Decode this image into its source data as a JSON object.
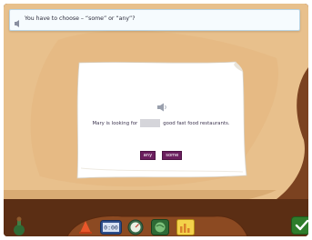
{
  "instruction": {
    "text": "You have to choose – “some” or “any”?"
  },
  "exercise": {
    "sentence_before": "Mary is looking for",
    "sentence_after": "good fast food restaurants.",
    "options": [
      "any",
      "some"
    ]
  },
  "toolbar": {
    "clock_display": "0:00",
    "icons": [
      "cone-icon",
      "clock-icon",
      "speedometer-icon",
      "globe-icon",
      "bar-chart-icon"
    ]
  },
  "colors": {
    "sand": "#e8c08c",
    "frame": "#6d3a1c",
    "option_button": "#6b1e5e",
    "check_button": "#2f7c2c"
  }
}
